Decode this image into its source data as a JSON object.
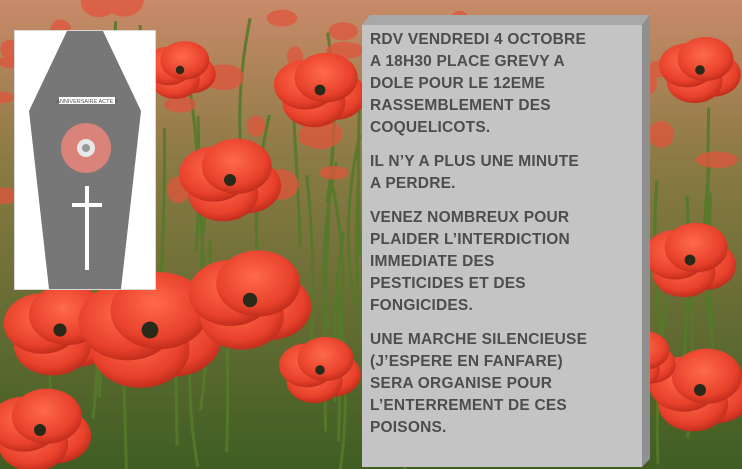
{
  "image": {
    "description_icon": "coffin-icon",
    "coffin": {
      "label": "ANNIVERSAIRE ACTE II",
      "poppy_icon": "poppy-icon",
      "cross_icon": "cross-icon"
    }
  },
  "message": {
    "paragraphs": [
      "RDV VENDREDI  4 OCTOBRE\nA 18H30 PLACE GREVY  A\nDOLE POUR LE 12EME\nRASSEMBLEMENT   DES\nCOQUELICOTS.",
      "IL N’Y A PLUS  UNE  MINUTE\nA  PERDRE.",
      "VENEZ NOMBREUX  POUR\nPLAIDER L’INTERDICTION\nIMMEDIATE   DES\nPESTICIDES  ET DES\nFONGICIDES.",
      "UNE MARCHE SILENCIEUSE\n(J’ESPERE EN FANFARE)\nSERA ORGANISE POUR\nL’ENTERREMENT DE CES\nPOISONS."
    ]
  },
  "colors": {
    "poppy": "#e8412c",
    "panel": "#c4c4c4",
    "text": "#4d4d4d",
    "coffin": "#777777",
    "poppy_badge": "#d9837a"
  }
}
